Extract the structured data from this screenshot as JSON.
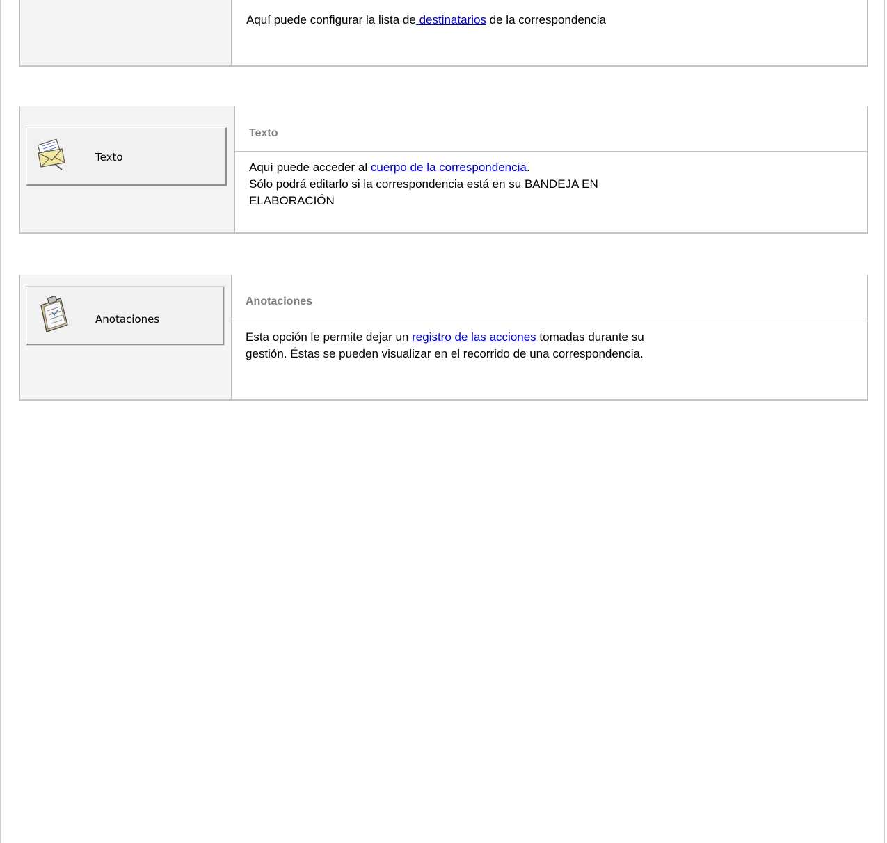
{
  "section_destinatarios": {
    "text_before": "Aquí puede configurar la lista de",
    "link": "destinatarios",
    "text_after": " de la correspondencia"
  },
  "section_texto": {
    "button_label": "Texto",
    "heading": "Texto",
    "line1_before": "Aquí puede acceder al ",
    "line1_link": "cuerpo de la correspondencia",
    "line1_after": ".",
    "line2": "Sólo podrá editarlo si la correspondencia  está en su BANDEJA EN",
    "line3": "ELABORACIÓN",
    "icon": "envelope-letter-icon"
  },
  "section_anotaciones": {
    "button_label": "Anotaciones",
    "heading": "Anotaciones",
    "line1_before": "Esta opción le permite dejar un ",
    "line1_link": "registro de las acciones",
    "line1_after": " tomadas durante su",
    "line2": "gestión. Éstas se pueden visualizar en el recorrido de una correspondencia.",
    "icon": "clipboard-notes-icon"
  },
  "colors": {
    "link": "#0000cc",
    "heading": "#7f7f7f",
    "border": "#c4c4c4"
  }
}
